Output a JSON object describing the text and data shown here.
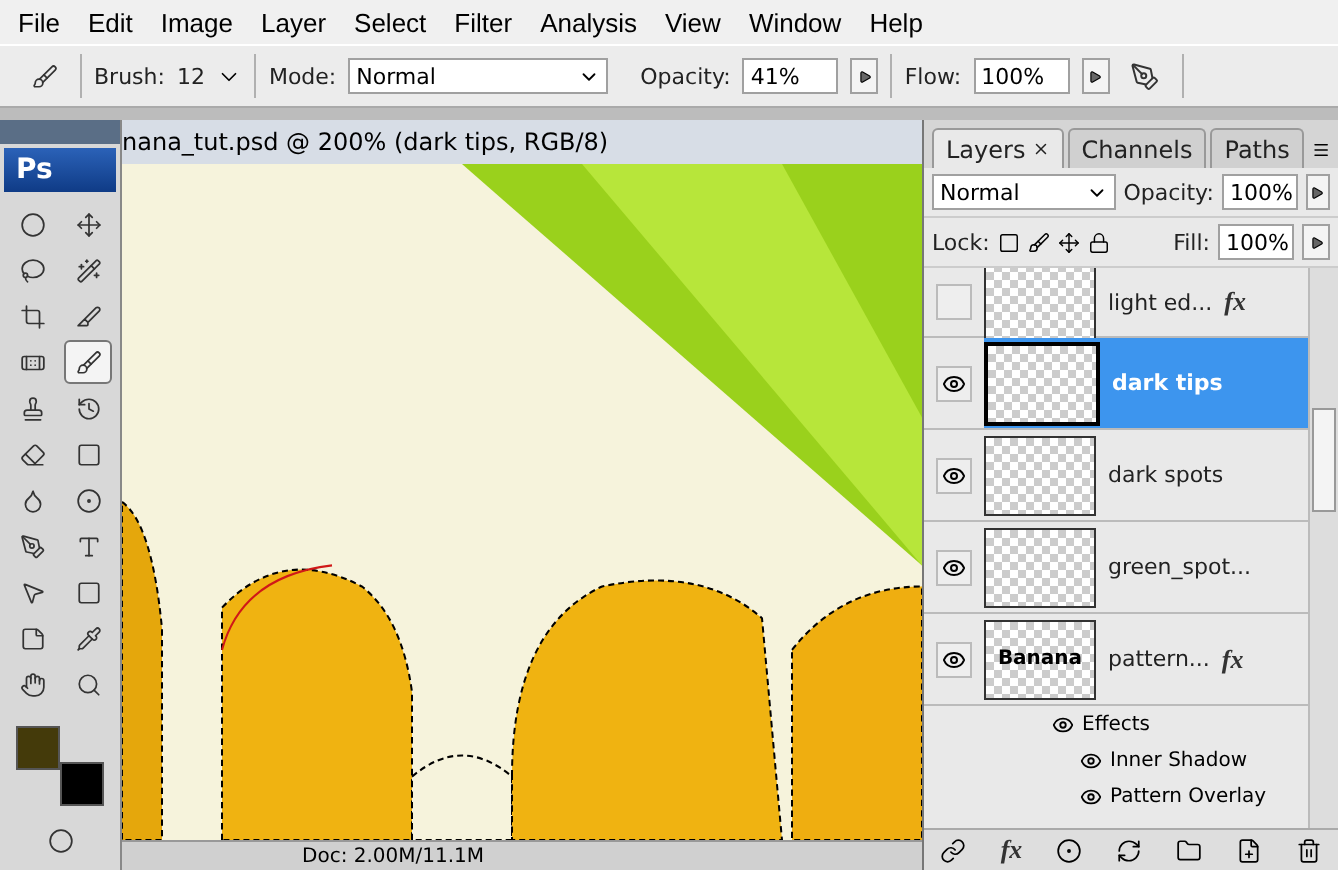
{
  "menu": [
    "File",
    "Edit",
    "Image",
    "Layer",
    "Select",
    "Filter",
    "Analysis",
    "View",
    "Window",
    "Help"
  ],
  "options": {
    "brush_label": "Brush:",
    "brush_size": "12",
    "mode_label": "Mode:",
    "mode": "Normal",
    "opacity_label": "Opacity:",
    "opacity": "41%",
    "flow_label": "Flow:",
    "flow": "100%"
  },
  "toolbox": {
    "logo": "Ps",
    "tools": [
      {
        "kind": "marquee",
        "selected": false
      },
      {
        "kind": "move",
        "selected": false
      },
      {
        "kind": "lasso",
        "selected": false
      },
      {
        "kind": "wand",
        "selected": false
      },
      {
        "kind": "crop",
        "selected": false
      },
      {
        "kind": "slice",
        "selected": false
      },
      {
        "kind": "heal",
        "selected": false
      },
      {
        "kind": "brush",
        "selected": true
      },
      {
        "kind": "stamp",
        "selected": false
      },
      {
        "kind": "history",
        "selected": false
      },
      {
        "kind": "eraser",
        "selected": false
      },
      {
        "kind": "gradient",
        "selected": false
      },
      {
        "kind": "blur",
        "selected": false
      },
      {
        "kind": "dodge",
        "selected": false
      },
      {
        "kind": "pen",
        "selected": false
      },
      {
        "kind": "type",
        "selected": false
      },
      {
        "kind": "path",
        "selected": false
      },
      {
        "kind": "shape",
        "selected": false
      },
      {
        "kind": "notes",
        "selected": false
      },
      {
        "kind": "eyedropper",
        "selected": false
      },
      {
        "kind": "hand",
        "selected": false
      },
      {
        "kind": "zoom",
        "selected": false
      }
    ],
    "swatches": true
  },
  "document": {
    "title": "nana_tut.psd @ 200% (dark tips, RGB/8)",
    "status": "Doc: 2.00M/11.1M"
  },
  "layers_panel": {
    "tabs": [
      {
        "label": "Layers",
        "selected": true
      },
      {
        "label": "Channels",
        "selected": false
      },
      {
        "label": "Paths",
        "selected": false
      }
    ],
    "blend_mode": "Normal",
    "opacity_label": "Opacity:",
    "opacity": "100%",
    "lock_label": "Lock:",
    "fill_label": "Fill:",
    "fill": "100%",
    "layers": [
      {
        "name": "light ed...",
        "visible": false,
        "selected": false,
        "fx": "fx"
      },
      {
        "name": "dark tips",
        "visible": true,
        "selected": true
      },
      {
        "name": "dark spots",
        "visible": true,
        "selected": false
      },
      {
        "name": "green_spot...",
        "visible": true,
        "selected": false
      },
      {
        "name": "pattern...",
        "visible": true,
        "selected": false,
        "fx": "fx",
        "thumbnail_text": "Banana"
      }
    ],
    "add_style_button": "fx",
    "effects": {
      "label": "Effects",
      "visible": true,
      "items": [
        {
          "name": "Inner Shadow",
          "visible": true
        },
        {
          "name": "Pattern Overlay",
          "visible": true
        }
      ]
    }
  }
}
